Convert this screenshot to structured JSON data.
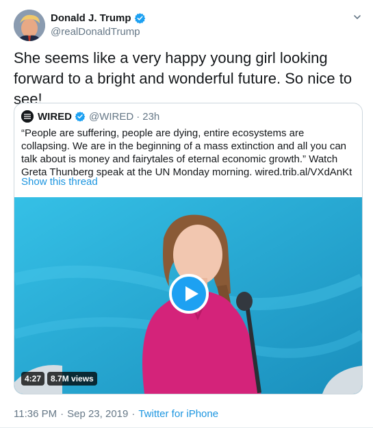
{
  "tweet": {
    "display_name": "Donald J. Trump",
    "handle": "@realDonaldTrump",
    "text": "She seems like a very happy young girl looking forward to a bright and wonderful future. So nice to see!",
    "timestamp": "11:36 PM",
    "date": "Sep 23, 2019",
    "source": "Twitter for iPhone"
  },
  "quote": {
    "display_name": "WIRED",
    "handle": "@WIRED",
    "age": "23h",
    "separator": "·",
    "text": "“People are suffering, people are dying, entire ecosystems are collapsing. We are in the beginning of a mass extinction and all you can talk about is money and fairytales of eternal economic growth.” Watch Greta Thunberg speak at the UN Monday morning. wired.trib.al/VXdAnKt",
    "show_thread": "Show this thread"
  },
  "video": {
    "duration": "4:27",
    "views": "8.7M views"
  },
  "icons": {
    "verified": "verified-badge-icon",
    "caret": "chevron-down-icon",
    "play": "play-icon"
  },
  "colors": {
    "accent": "#1da1f2",
    "link": "#1b95e0",
    "secondary_text": "#657786",
    "border": "#ccd6dd"
  }
}
